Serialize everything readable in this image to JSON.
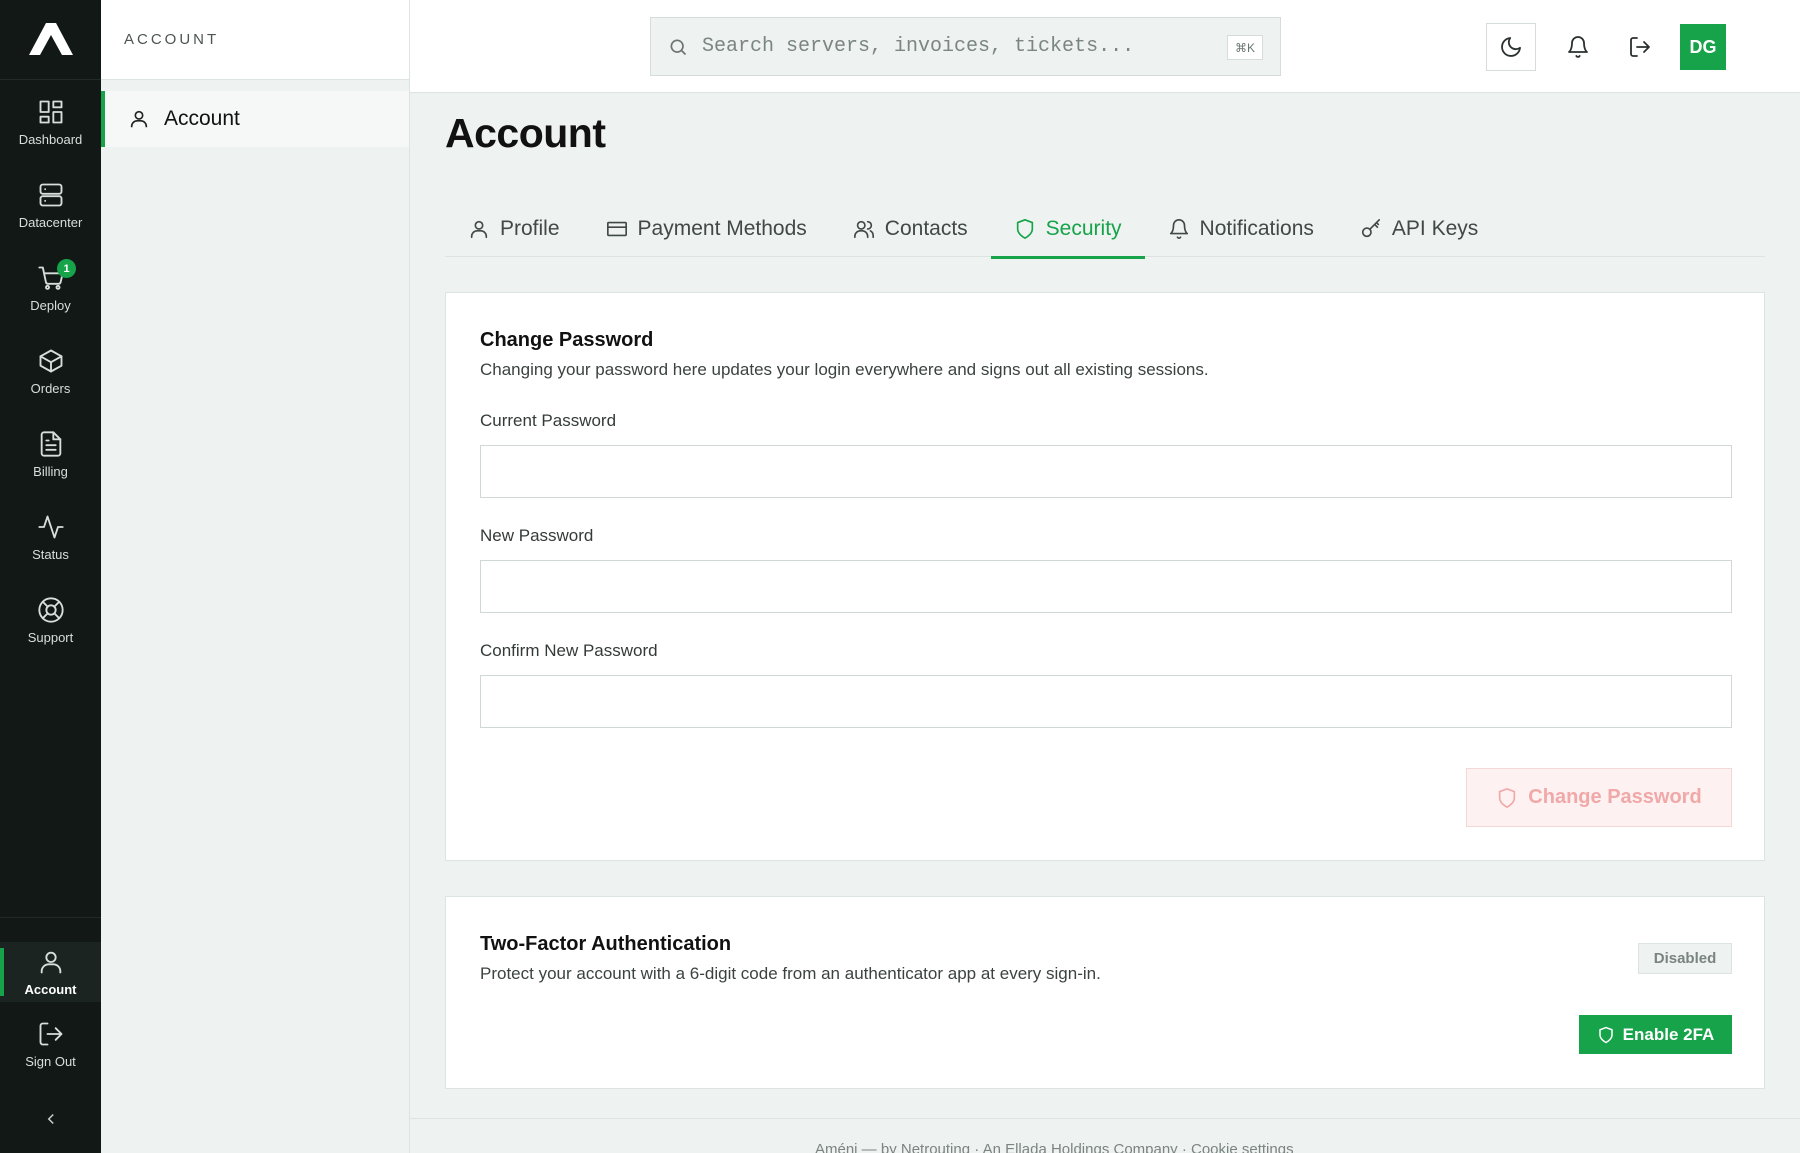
{
  "rail": {
    "items": [
      {
        "label": "Dashboard",
        "icon": "dashboard-icon"
      },
      {
        "label": "Datacenter",
        "icon": "server-icon"
      },
      {
        "label": "Deploy",
        "icon": "cart-icon",
        "badge": "1"
      },
      {
        "label": "Orders",
        "icon": "package-icon"
      },
      {
        "label": "Billing",
        "icon": "file-text-icon"
      },
      {
        "label": "Status",
        "icon": "activity-icon"
      },
      {
        "label": "Support",
        "icon": "lifebuoy-icon"
      }
    ],
    "bottom": [
      {
        "label": "Account",
        "icon": "user-icon"
      },
      {
        "label": "Sign Out",
        "icon": "sign-out-icon"
      }
    ]
  },
  "subpanel": {
    "heading": "ACCOUNT",
    "item": "Account"
  },
  "topbar": {
    "search_placeholder": "Search servers, invoices, tickets...",
    "search_shortcut": "⌘K",
    "avatar_initials": "DG"
  },
  "page": {
    "title": "Account",
    "tabs": [
      "Profile",
      "Payment Methods",
      "Contacts",
      "Security",
      "Notifications",
      "API Keys"
    ],
    "active_tab": "Security"
  },
  "change_password": {
    "title": "Change Password",
    "description": "Changing your password here updates your login everywhere and signs out all existing sessions.",
    "current_label": "Current Password",
    "new_label": "New Password",
    "confirm_label": "Confirm New Password",
    "current_value": "",
    "new_value": "",
    "confirm_value": "",
    "button": "Change Password"
  },
  "two_factor": {
    "title": "Two-Factor Authentication",
    "description": "Protect your account with a 6-digit code from an authenticator app at every sign-in.",
    "status": "Disabled",
    "button": "Enable 2FA"
  },
  "footer": {
    "text": "Améni — by Netrouting · An Ellada Holdings Company · Cookie settings"
  },
  "colors": {
    "accent": "#16a34a",
    "rail_bg": "#121816",
    "page_bg": "#eef2f0",
    "danger_soft": "#f0a8a8"
  }
}
